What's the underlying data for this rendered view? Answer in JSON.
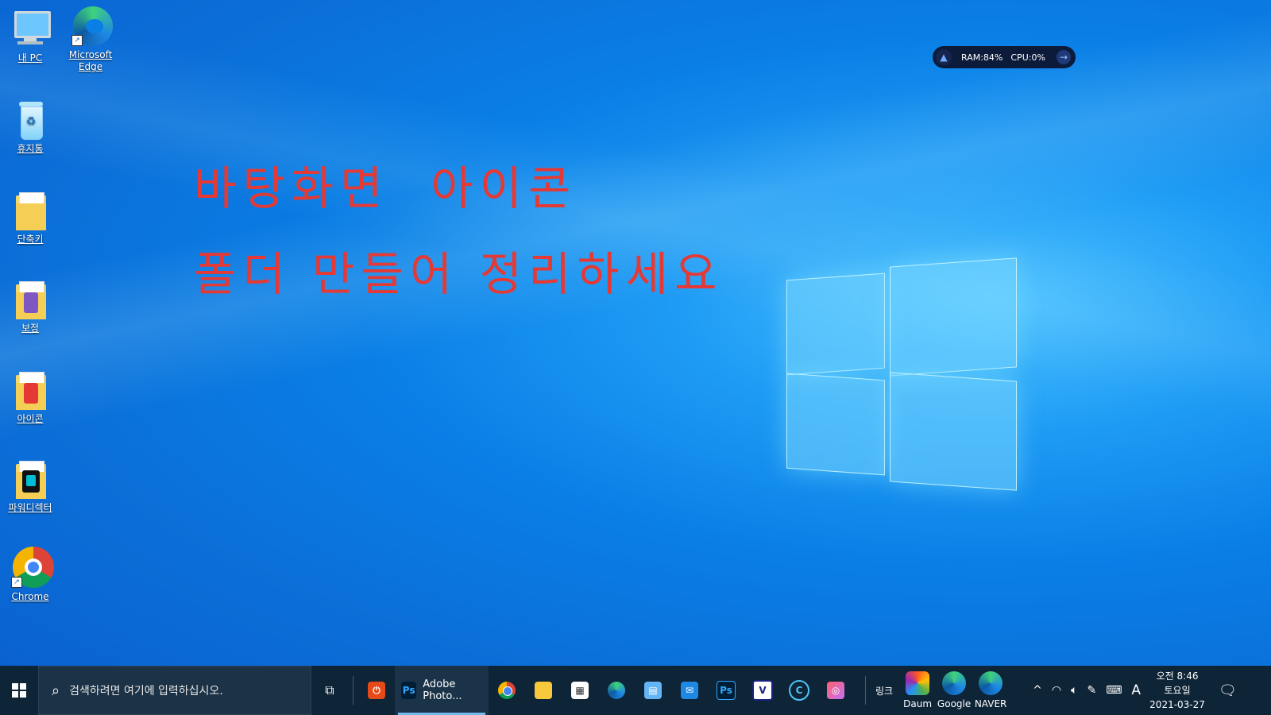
{
  "desktop": {
    "icons": [
      {
        "label": "내 PC",
        "icon": "pc-icon"
      },
      {
        "label": "Microsoft Edge",
        "icon": "edge-icon"
      },
      {
        "label": "휴지통",
        "icon": "recycle-bin-icon"
      },
      {
        "label": "단축키",
        "icon": "folder-icon"
      },
      {
        "label": "보정",
        "icon": "folder-icon"
      },
      {
        "label": "아이콘",
        "icon": "folder-icon"
      },
      {
        "label": "파워디렉터",
        "icon": "folder-icon"
      },
      {
        "label": "Chrome",
        "icon": "chrome-icon"
      }
    ],
    "overlay_line1": "바탕화면  아이콘",
    "overlay_line2": "폴더 만들어 정리하세요",
    "overlay_color": "#e53935"
  },
  "widget": {
    "ram": "RAM:84%",
    "cpu": "CPU:0%"
  },
  "taskbar": {
    "search_placeholder": "검색하려면 여기에 입력하십시오.",
    "running_app": "Adobe Photo...",
    "link_label": "링크",
    "links": [
      "Daum",
      "Google",
      "NAVER"
    ],
    "ime": "A",
    "clock": {
      "time": "오전 8:46",
      "day": "토요일",
      "date": "2021-03-27"
    }
  }
}
